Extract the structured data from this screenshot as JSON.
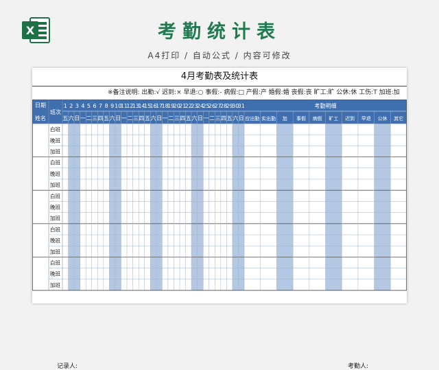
{
  "banner": {
    "title": "考勤统计表",
    "subtitle": "A4打印 / 自动公式 / 内容可修改"
  },
  "app_icon": {
    "name": "excel-icon",
    "letter": "X"
  },
  "sheet": {
    "title": "4月考勤表及统计表",
    "legend": "※备注说明: 出勤:√  迟到:×  早退:○  事假:-  病假:□  产假:产  婚假:婚  丧假:丧  旷工:旷  公休:休  工伤:T  加班:加",
    "header_date": "日期",
    "header_name": "姓名",
    "header_shift": "班次",
    "days": [
      "1",
      "2",
      "3",
      "4",
      "5",
      "6",
      "7",
      "8",
      "9",
      "10",
      "11",
      "12",
      "13",
      "14",
      "15",
      "16",
      "17",
      "18",
      "19",
      "20",
      "21",
      "22",
      "23",
      "24",
      "25",
      "26",
      "27",
      "28",
      "29",
      "30",
      "31"
    ],
    "weekdays": [
      "五",
      "六",
      "日",
      "一",
      "二",
      "三",
      "四",
      "五",
      "六",
      "日",
      "一",
      "二",
      "三",
      "四",
      "五",
      "六",
      "日",
      "一",
      "二",
      "三",
      "四",
      "五",
      "六",
      "日",
      "一",
      "二",
      "三",
      "四",
      "五",
      "六",
      "日"
    ],
    "stats_title": "考勤明细",
    "stats_columns": [
      "应出勤",
      "实出勤",
      "加",
      "事假",
      "病假",
      "旷工",
      "迟到",
      "早退",
      "公休",
      "其它"
    ],
    "shifts": [
      "白班",
      "晚班",
      "加班"
    ],
    "employee_groups": 5,
    "recorder_label": "记录人:",
    "checker_label": "考勤人:"
  },
  "colors": {
    "brand_green": "#1f7a4d",
    "header_blue": "#3f6fae",
    "weekend_fill": "#b4c8e4",
    "grid_line": "#9fb1c8"
  }
}
